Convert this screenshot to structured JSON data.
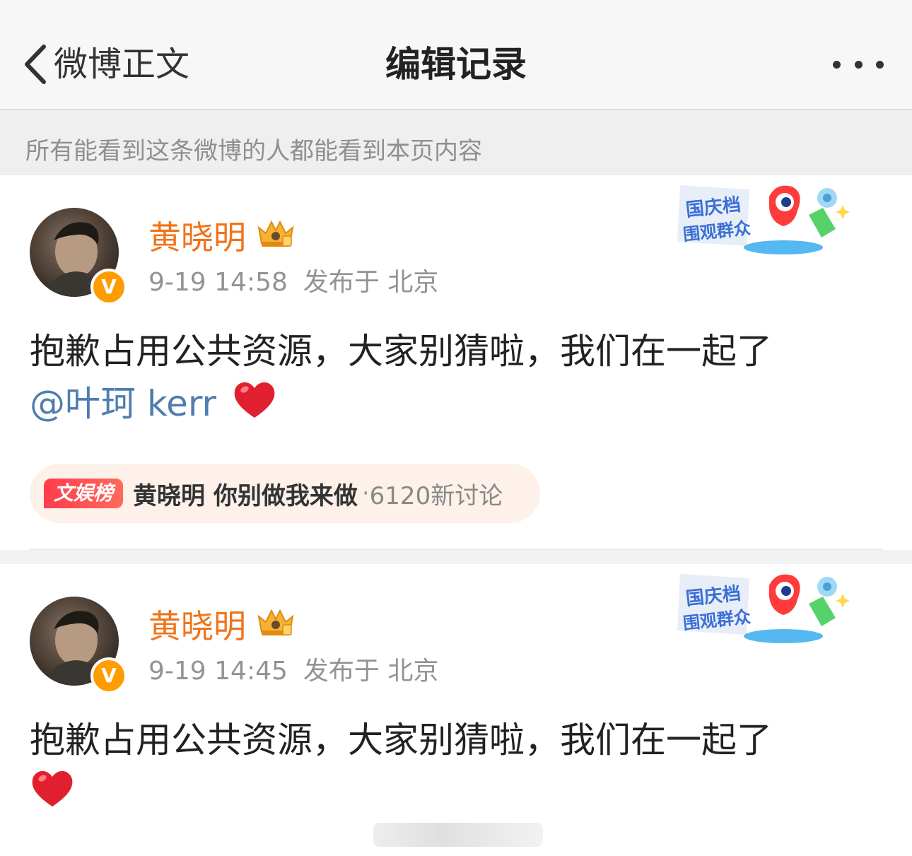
{
  "nav": {
    "back_label": "微博正文",
    "title": "编辑记录"
  },
  "notice": {
    "text": "所有能看到这条微博的人都能看到本页内容"
  },
  "posts": [
    {
      "username": "黄晓明",
      "time": "9-19 14:58",
      "location": "发布于 北京",
      "verified_badge": "V",
      "text": "抱歉占用公共资源，大家别猜啦，我们在一起了",
      "mention": "@叶珂 kerr",
      "emoji": "heart-icon",
      "topic": {
        "tag": "文娱榜",
        "name": "黄晓明 你别做我来做",
        "separator": "·",
        "count": "6120新讨论"
      }
    },
    {
      "username": "黄晓明",
      "time": "9-19 14:45",
      "location": "发布于 北京",
      "verified_badge": "V",
      "text": "抱歉占用公共资源，大家别猜啦，我们在一起了",
      "emoji": "heart-icon"
    }
  ],
  "sticker": {
    "line1": "国庆档",
    "line2": "围观群众"
  },
  "colors": {
    "username": "#f0741a",
    "mention": "#507daf",
    "verify_badge": "#ff9c00",
    "topic_pill_bg": "#fdf1e9"
  }
}
